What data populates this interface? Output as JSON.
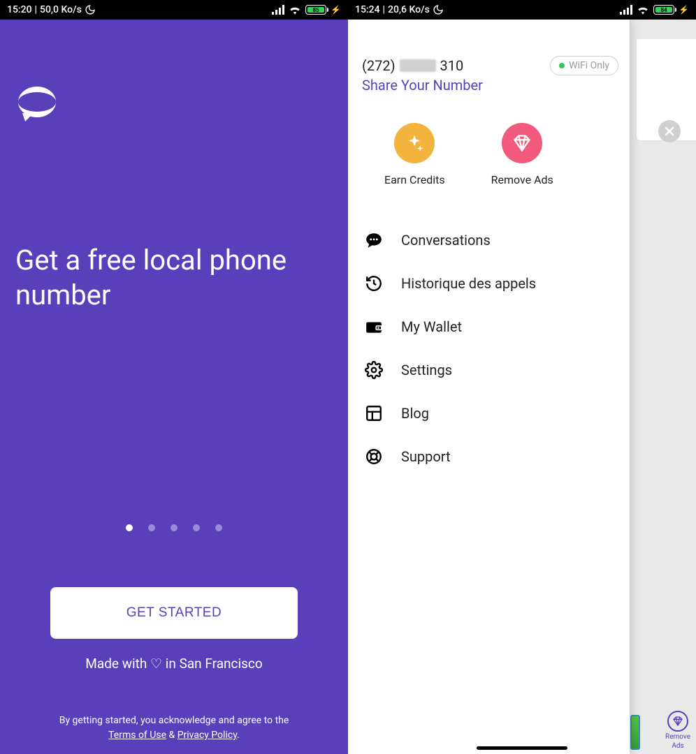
{
  "left": {
    "status": {
      "time": "15:20",
      "rate": "50,0 Ko/s",
      "battery": "85"
    },
    "headline": "Get a free local phone number",
    "get_started": "GET STARTED",
    "made_with": "Made with ♡ in San Francisco",
    "disclaimer_intro": "By getting started, you acknowledge and agree to the",
    "terms": "Terms of Use",
    "amp": "&",
    "privacy": "Privacy Policy",
    "dot_active_index": 0,
    "dot_count": 5
  },
  "right": {
    "status": {
      "time": "15:24",
      "rate": "20,6 Ko/s",
      "battery": "84"
    },
    "phone_area": "(272)",
    "phone_last": "310",
    "share_label": "Share Your Number",
    "wifi_chip": "WiFi Only",
    "actions": {
      "earn": "Earn Credits",
      "remove": "Remove Ads"
    },
    "menu": {
      "conversations": "Conversations",
      "history": "Historique des appels",
      "wallet": "My Wallet",
      "settings": "Settings",
      "blog": "Blog",
      "support": "Support"
    },
    "corner": {
      "remove1": "Remove",
      "remove2": "Ads"
    }
  }
}
